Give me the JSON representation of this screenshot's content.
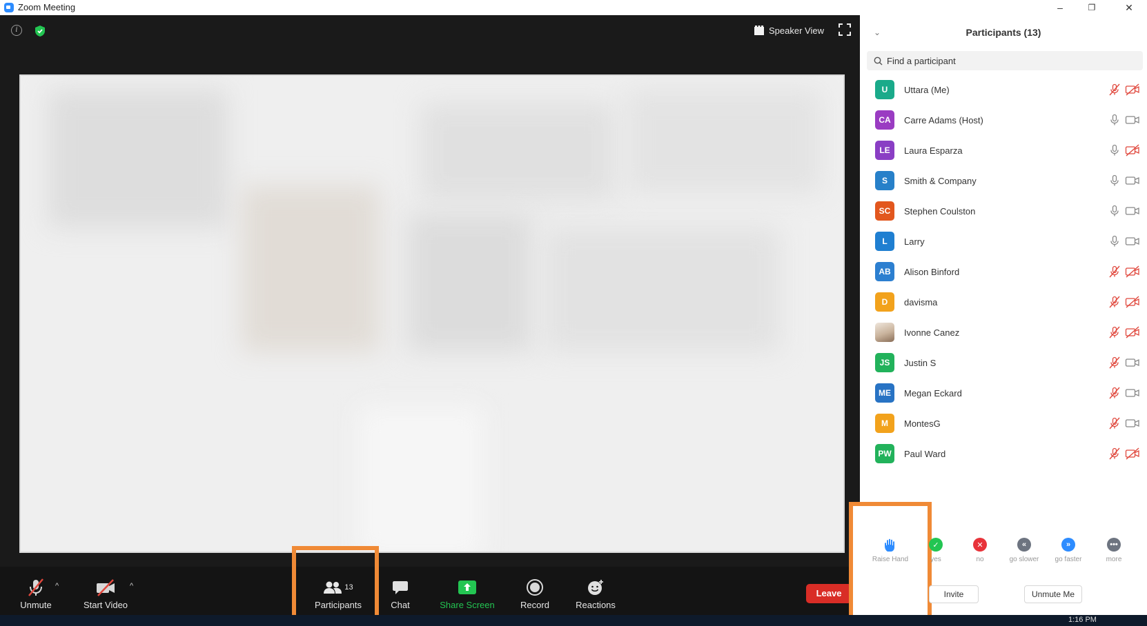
{
  "window": {
    "title": "Zoom Meeting",
    "minimize": "–",
    "restore": "❐",
    "close": "✕"
  },
  "meeting": {
    "speaker_view_label": "Speaker View"
  },
  "toolbar": {
    "unmute": "Unmute",
    "start_video": "Start Video",
    "participants": "Participants",
    "participants_count": "13",
    "chat": "Chat",
    "share_screen": "Share Screen",
    "record": "Record",
    "reactions": "Reactions",
    "leave": "Leave"
  },
  "colors": {
    "share_green": "#23c552",
    "leave_red": "#d92d26",
    "highlight_orange": "#f08a36",
    "muted_red": "#e0473c"
  },
  "panel": {
    "title": "Participants (13)",
    "search_placeholder": "Find a participant",
    "participants": [
      {
        "initials": "U",
        "name": "Uttara (Me)",
        "color": "#1aaa8a",
        "mic": "muted",
        "cam": "off"
      },
      {
        "initials": "CA",
        "name": "Carre Adams (Host)",
        "color": "#9a3cc2",
        "mic": "on",
        "cam": "on"
      },
      {
        "initials": "LE",
        "name": "Laura Esparza",
        "color": "#8a3ec4",
        "mic": "on",
        "cam": "off"
      },
      {
        "initials": "S",
        "name": "Smith & Company",
        "color": "#2780c9",
        "mic": "on",
        "cam": "on"
      },
      {
        "initials": "SC",
        "name": "Stephen Coulston",
        "color": "#e2571e",
        "mic": "on",
        "cam": "on"
      },
      {
        "initials": "L",
        "name": "Larry",
        "color": "#1f7fd1",
        "mic": "on",
        "cam": "on"
      },
      {
        "initials": "AB",
        "name": "Alison Binford",
        "color": "#2c7fd0",
        "mic": "muted",
        "cam": "off"
      },
      {
        "initials": "D",
        "name": "davisma",
        "color": "#f2a21c",
        "mic": "muted",
        "cam": "off"
      },
      {
        "initials": "",
        "name": "Ivonne Canez",
        "color": "#d8c8b8",
        "mic": "muted",
        "cam": "off",
        "photo": true
      },
      {
        "initials": "JS",
        "name": "Justin S",
        "color": "#22b25b",
        "mic": "muted",
        "cam": "on"
      },
      {
        "initials": "ME",
        "name": "Megan Eckard",
        "color": "#2873c4",
        "mic": "muted",
        "cam": "on"
      },
      {
        "initials": "M",
        "name": "MontesG",
        "color": "#f2a21c",
        "mic": "muted",
        "cam": "on"
      },
      {
        "initials": "PW",
        "name": "Paul Ward",
        "color": "#22b25b",
        "mic": "muted",
        "cam": "off"
      }
    ],
    "reactions": {
      "raise_hand": "Raise Hand",
      "yes": "yes",
      "no": "no",
      "go_slower": "go slower",
      "go_faster": "go faster",
      "more": "more"
    },
    "invite": "Invite",
    "unmute_me": "Unmute Me"
  },
  "taskbar": {
    "clock": "1:16 PM"
  }
}
